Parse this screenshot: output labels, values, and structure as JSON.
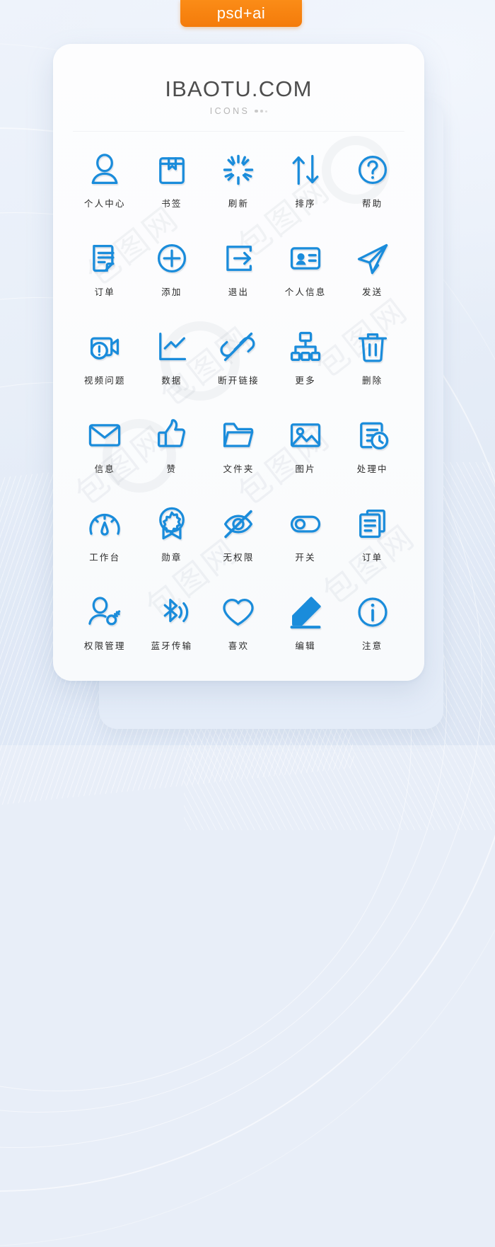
{
  "tag": {
    "label": "psd+ai"
  },
  "header": {
    "brand": "IBAOTU.COM",
    "subtitle": "ICONS"
  },
  "watermark": {
    "text": "包图网"
  },
  "colors": {
    "icon_blue": "#1a8cdb",
    "tag_orange": "#f47b0a",
    "brand_text": "#4d4d4d",
    "label_text": "#2a2a2a",
    "card_bg": "#fbfcfd",
    "page_bg": "#e8eef8"
  },
  "grid": {
    "columns": 5,
    "rows": 6,
    "icons": [
      {
        "label": "个人中心",
        "icon": "user-avatar-icon"
      },
      {
        "label": "书签",
        "icon": "bookmark-icon"
      },
      {
        "label": "刷新",
        "icon": "refresh-burst-icon"
      },
      {
        "label": "排序",
        "icon": "sort-arrows-icon"
      },
      {
        "label": "帮助",
        "icon": "help-question-icon"
      },
      {
        "label": "订单",
        "icon": "order-document-icon"
      },
      {
        "label": "添加",
        "icon": "add-plus-circle-icon"
      },
      {
        "label": "退出",
        "icon": "exit-logout-icon"
      },
      {
        "label": "个人信息",
        "icon": "id-card-icon"
      },
      {
        "label": "发送",
        "icon": "send-plane-icon"
      },
      {
        "label": "视频问题",
        "icon": "video-warning-icon"
      },
      {
        "label": "数据",
        "icon": "data-chart-icon"
      },
      {
        "label": "断开链接",
        "icon": "broken-link-icon"
      },
      {
        "label": "更多",
        "icon": "sitemap-more-icon"
      },
      {
        "label": "删除",
        "icon": "trash-delete-icon"
      },
      {
        "label": "信息",
        "icon": "envelope-message-icon"
      },
      {
        "label": "赞",
        "icon": "thumbs-up-icon"
      },
      {
        "label": "文件夹",
        "icon": "folder-icon"
      },
      {
        "label": "图片",
        "icon": "image-picture-icon"
      },
      {
        "label": "处理中",
        "icon": "processing-clock-icon"
      },
      {
        "label": "工作台",
        "icon": "dashboard-gauge-icon"
      },
      {
        "label": "勋章",
        "icon": "medal-badge-icon"
      },
      {
        "label": "无权限",
        "icon": "eye-off-icon"
      },
      {
        "label": "开关",
        "icon": "toggle-switch-icon"
      },
      {
        "label": "订单",
        "icon": "documents-stack-icon"
      },
      {
        "label": "权限管理",
        "icon": "user-key-permission-icon"
      },
      {
        "label": "蓝牙传输",
        "icon": "bluetooth-transfer-icon"
      },
      {
        "label": "喜欢",
        "icon": "heart-favorite-icon"
      },
      {
        "label": "编辑",
        "icon": "pencil-edit-icon"
      },
      {
        "label": "注意",
        "icon": "info-notice-icon"
      }
    ]
  }
}
